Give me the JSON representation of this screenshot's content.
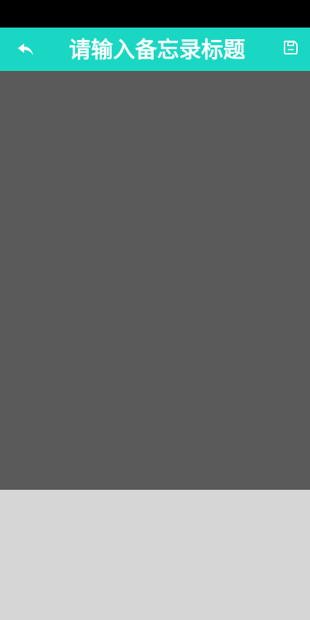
{
  "header": {
    "title_placeholder": "请输入备忘录标题",
    "back_icon": "reply-arrow-icon",
    "save_icon": "floppy-disk-icon"
  },
  "content": {
    "body_value": ""
  },
  "colors": {
    "status_bar": "#000000",
    "app_bar": "#1ad7c3",
    "content_background": "#5a5a5a",
    "bottom_background": "#d6d6d6",
    "icon": "#ffffff"
  }
}
